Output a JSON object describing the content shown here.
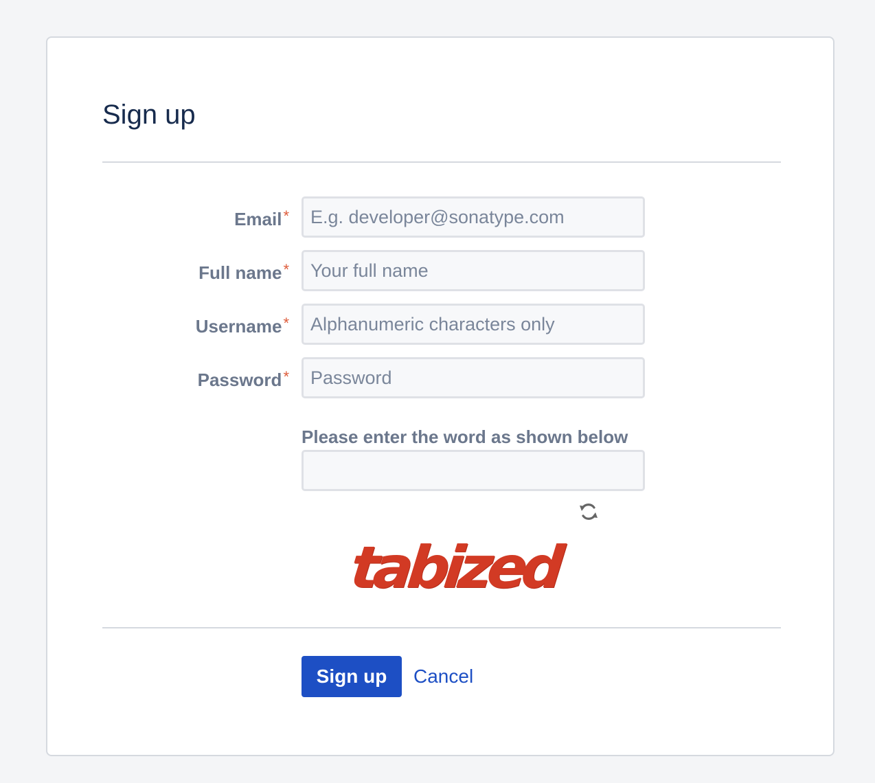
{
  "form": {
    "title": "Sign up",
    "required_marker": "*",
    "fields": [
      {
        "label": "Email",
        "placeholder": "E.g. developer@sonatype.com",
        "value": ""
      },
      {
        "label": "Full name",
        "placeholder": "Your full name",
        "value": ""
      },
      {
        "label": "Username",
        "placeholder": "Alphanumeric characters only",
        "value": ""
      },
      {
        "label": "Password",
        "placeholder": "Password",
        "value": ""
      }
    ],
    "captcha": {
      "label": "Please enter the word as shown below",
      "value": "",
      "word": "tabized",
      "refresh_icon": "refresh-icon"
    },
    "submit_label": "Sign up",
    "cancel_label": "Cancel"
  },
  "colors": {
    "page_background": "#f4f5f7",
    "title": "#172b4d",
    "label": "#6b778c",
    "required": "#de5c3b",
    "primary": "#1d4fc4",
    "captcha_text": "#d23a24"
  }
}
